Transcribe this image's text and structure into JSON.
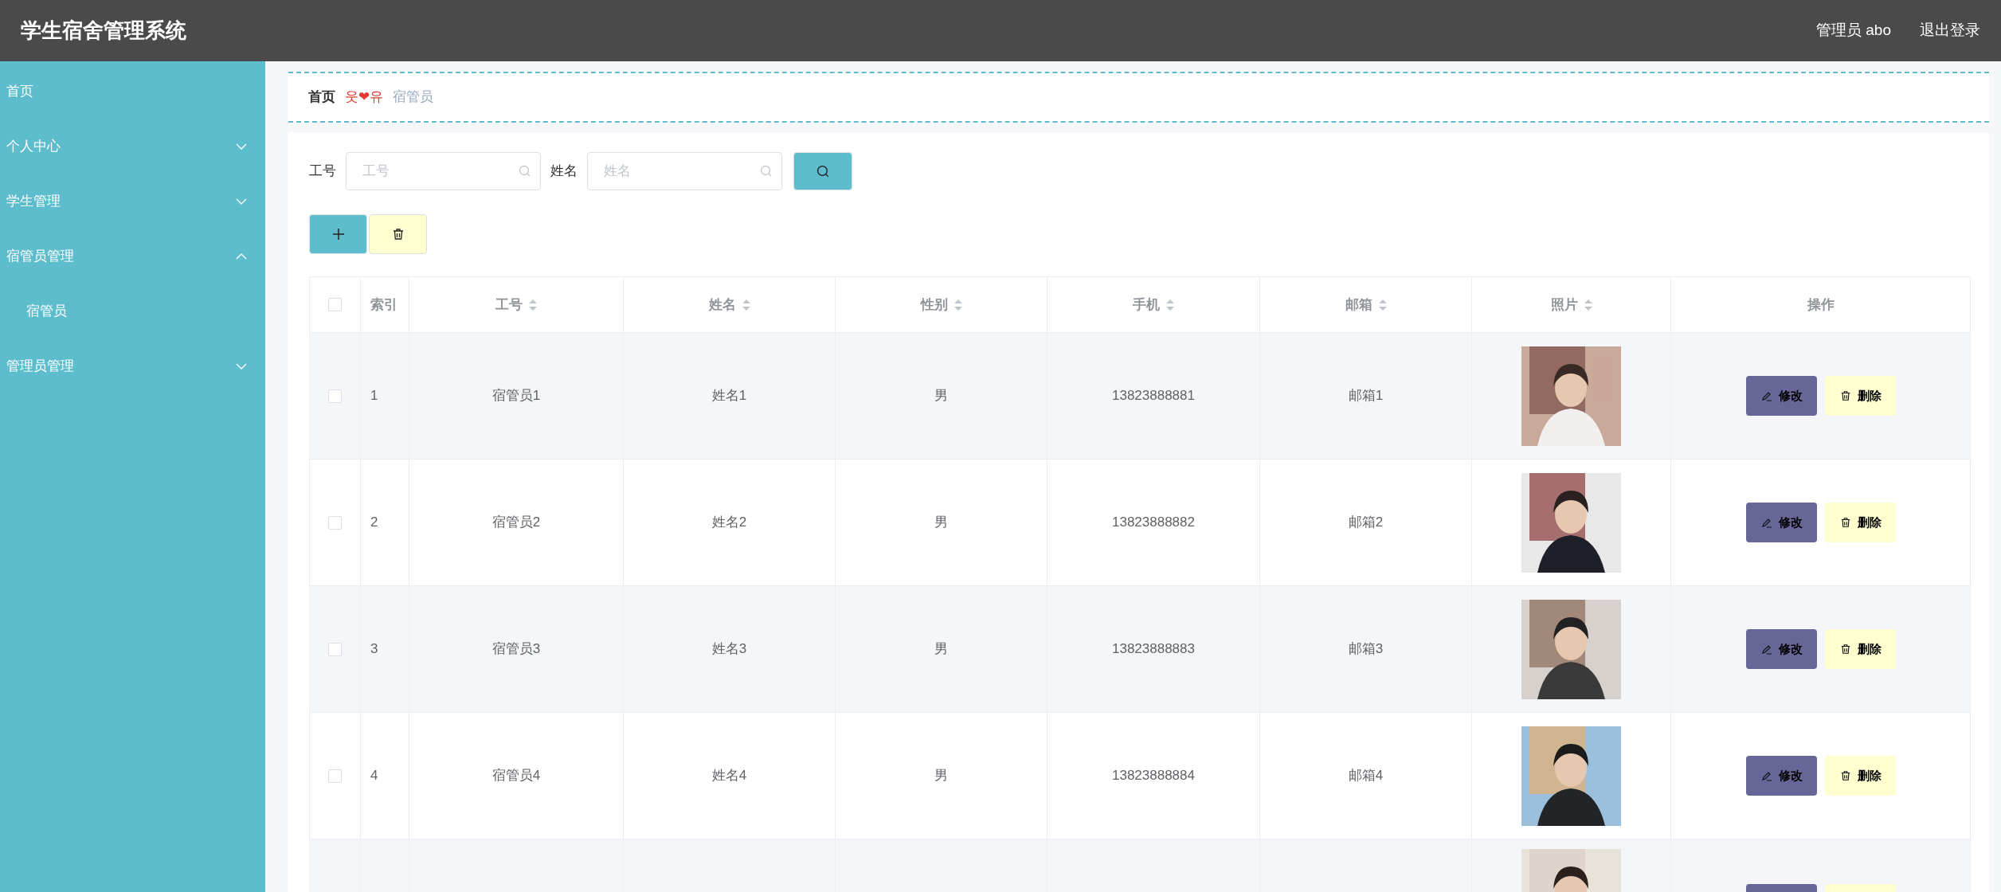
{
  "header": {
    "title": "学生宿舍管理系统",
    "user": "管理员 abo",
    "logout": "退出登录"
  },
  "sidebar": {
    "items": [
      {
        "label": "首页",
        "kind": "link"
      },
      {
        "label": "个人中心",
        "kind": "submenu",
        "expanded": false
      },
      {
        "label": "学生管理",
        "kind": "submenu",
        "expanded": false
      },
      {
        "label": "宿管员管理",
        "kind": "submenu",
        "expanded": true,
        "children": [
          {
            "label": "宿管员"
          }
        ]
      },
      {
        "label": "管理员管理",
        "kind": "submenu",
        "expanded": false
      }
    ]
  },
  "breadcrumb": {
    "home": "首页",
    "separator": "웃❤유",
    "current": "宿管员"
  },
  "search": {
    "fields": [
      {
        "label": "工号",
        "placeholder": "工号"
      },
      {
        "label": "姓名",
        "placeholder": "姓名"
      }
    ]
  },
  "table": {
    "select_all": {
      "checked": false
    },
    "columns": [
      {
        "label": "索引",
        "sortable": false
      },
      {
        "label": "工号",
        "sortable": true
      },
      {
        "label": "姓名",
        "sortable": true
      },
      {
        "label": "性别",
        "sortable": true
      },
      {
        "label": "手机",
        "sortable": true
      },
      {
        "label": "邮箱",
        "sortable": true
      },
      {
        "label": "照片",
        "sortable": true
      },
      {
        "label": "操作",
        "sortable": false
      }
    ],
    "rows": [
      {
        "kind": "full",
        "checked": false,
        "index": "1",
        "id": "宿管员1",
        "name": "姓名1",
        "gender": "男",
        "phone": "13823888881",
        "email": "邮箱1",
        "edit": "修改",
        "delete": "删除"
      },
      {
        "kind": "full",
        "checked": false,
        "index": "2",
        "id": "宿管员2",
        "name": "姓名2",
        "gender": "男",
        "phone": "13823888882",
        "email": "邮箱2",
        "edit": "修改",
        "delete": "删除"
      },
      {
        "kind": "full",
        "checked": false,
        "index": "3",
        "id": "宿管员3",
        "name": "姓名3",
        "gender": "男",
        "phone": "13823888883",
        "email": "邮箱3",
        "edit": "修改",
        "delete": "删除"
      },
      {
        "kind": "full",
        "checked": false,
        "index": "4",
        "id": "宿管员4",
        "name": "姓名4",
        "gender": "男",
        "phone": "13823888884",
        "email": "邮箱4",
        "edit": "修改",
        "delete": "删除"
      },
      {
        "kind": "partial"
      }
    ]
  }
}
